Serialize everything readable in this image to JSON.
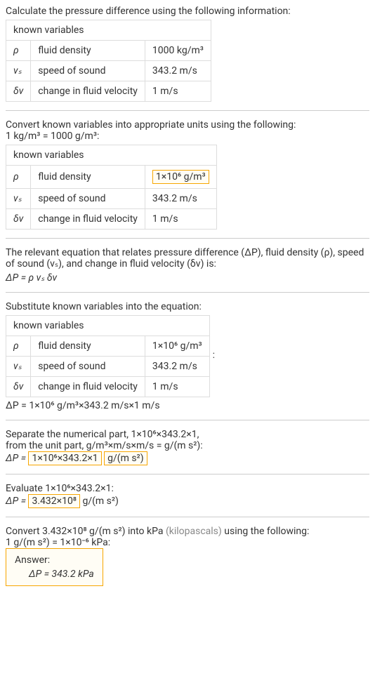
{
  "step1": {
    "intro": "Calculate the pressure difference using the following information:",
    "table_header": "known variables",
    "rows": [
      {
        "symbol": "ρ",
        "desc": "fluid density",
        "value": "1000 kg/m³"
      },
      {
        "symbol": "vₛ",
        "desc": "speed of sound",
        "value": "343.2 m/s"
      },
      {
        "symbol": "δv",
        "desc": "change in fluid velocity",
        "value": "1 m/s"
      }
    ]
  },
  "step2": {
    "intro": "Convert known variables into appropriate units using the following:",
    "conversion": "1 kg/m³ = 1000 g/m³:",
    "table_header": "known variables",
    "rows": [
      {
        "symbol": "ρ",
        "desc": "fluid density",
        "value": "1×10⁶ g/m³",
        "highlight": true
      },
      {
        "symbol": "vₛ",
        "desc": "speed of sound",
        "value": "343.2 m/s"
      },
      {
        "symbol": "δv",
        "desc": "change in fluid velocity",
        "value": "1 m/s"
      }
    ]
  },
  "step3": {
    "intro1": "The relevant equation that relates pressure difference (ΔP), fluid density (ρ), speed of sound (vₛ), and change in fluid velocity (δv) is:",
    "equation": "ΔP = ρ vₛ δv"
  },
  "step4": {
    "intro": "Substitute known variables into the equation:",
    "table_header": "known variables",
    "rows": [
      {
        "symbol": "ρ",
        "desc": "fluid density",
        "value": "1×10⁶ g/m³"
      },
      {
        "symbol": "vₛ",
        "desc": "speed of sound",
        "value": "343.2 m/s"
      },
      {
        "symbol": "δv",
        "desc": "change in fluid velocity",
        "value": "1 m/s"
      }
    ],
    "colon": ":",
    "equation": "ΔP = 1×10⁶ g/m³×343.2 m/s×1 m/s"
  },
  "step5": {
    "intro1": "Separate the numerical part, 1×10⁶×343.2×1,",
    "intro2": "from the unit part, g/m³×m/s×m/s = g/(m s²):",
    "eq_prefix": "ΔP = ",
    "eq_highlight": "1×10⁶×343.2×1",
    "eq_suffix_highlight": "g/(m s²)"
  },
  "step6": {
    "intro": "Evaluate 1×10⁶×343.2×1:",
    "eq_prefix": "ΔP = ",
    "eq_highlight": "3.432×10⁸",
    "eq_suffix": " g/(m s²)"
  },
  "step7": {
    "intro1": "Convert 3.432×10⁸ g/(m s²) into kPa ",
    "intro_gray": "(kilopascals)",
    "intro2": " using the following:",
    "conversion": "1 g/(m s²) = 1×10⁻⁶ kPa:",
    "answer_label": "Answer:",
    "answer_value": "ΔP = 343.2 kPa"
  }
}
